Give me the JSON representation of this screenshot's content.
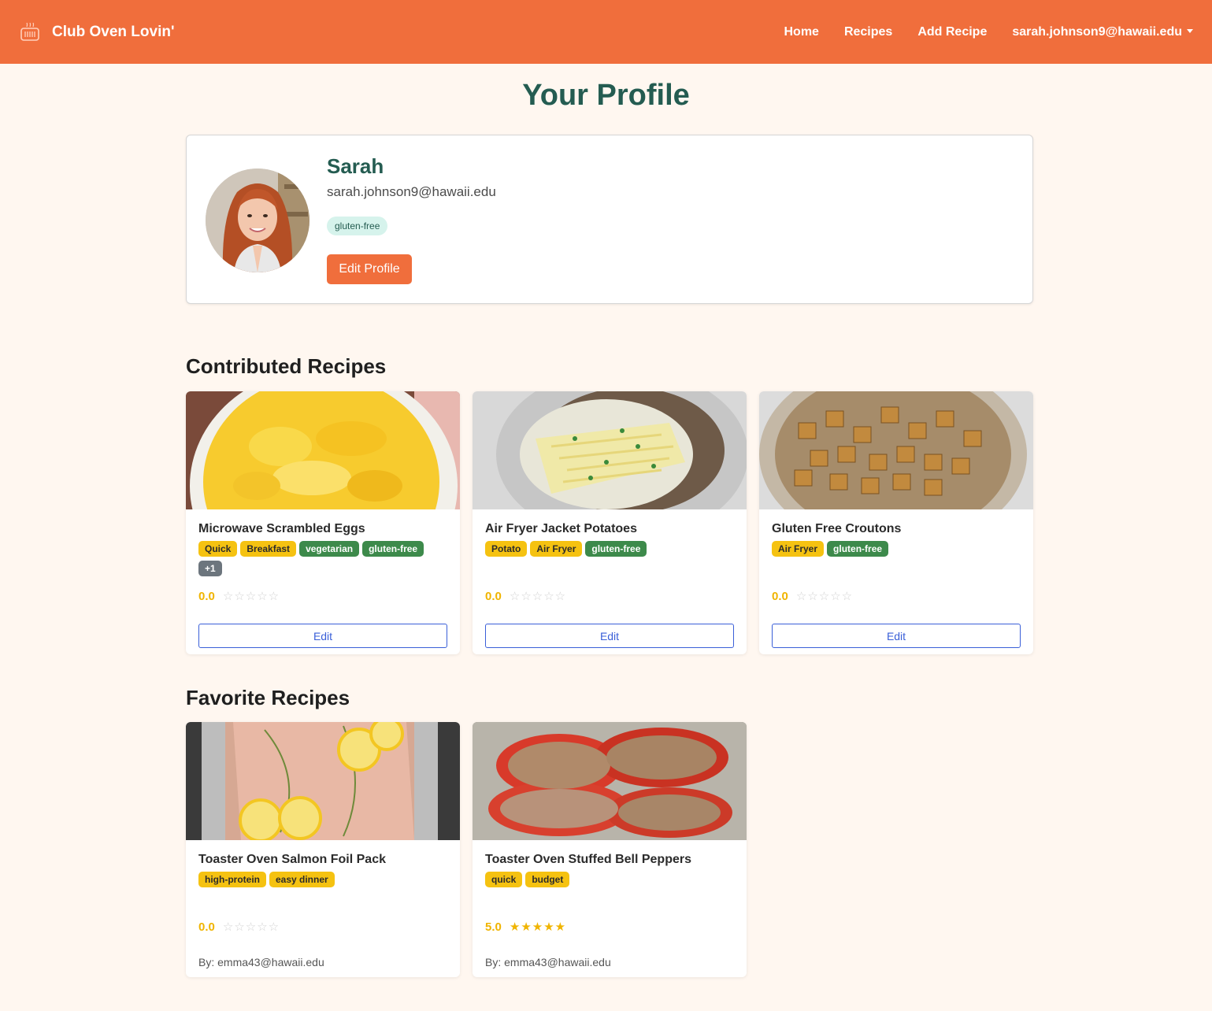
{
  "nav": {
    "brand": "Club Oven Lovin'",
    "brand_icon": "toaster-oven-icon",
    "links": [
      "Home",
      "Recipes",
      "Add Recipe"
    ],
    "user": "sarah.johnson9@hawaii.edu"
  },
  "page": {
    "title": "Your Profile"
  },
  "profile": {
    "name": "Sarah",
    "email": "sarah.johnson9@hawaii.edu",
    "dietary_tag": "gluten-free",
    "edit_label": "Edit Profile"
  },
  "contributed": {
    "heading": "Contributed Recipes",
    "recipes": [
      {
        "title": "Microwave Scrambled Eggs",
        "tags": [
          "Quick",
          "Breakfast",
          "vegetarian",
          "gluten-free",
          "+1"
        ],
        "rating": "0.0",
        "stars": 0,
        "button": "Edit"
      },
      {
        "title": "Air Fryer Jacket Potatoes",
        "tags": [
          "Potato",
          "Air Fryer",
          "gluten-free"
        ],
        "rating": "0.0",
        "stars": 0,
        "button": "Edit"
      },
      {
        "title": "Gluten Free Croutons",
        "tags": [
          "Air Fryer",
          "gluten-free"
        ],
        "rating": "0.0",
        "stars": 0,
        "button": "Edit"
      }
    ]
  },
  "favorites": {
    "heading": "Favorite Recipes",
    "recipes": [
      {
        "title": "Toaster Oven Salmon Foil Pack",
        "tags": [
          "high-protein",
          "easy dinner"
        ],
        "rating": "0.0",
        "stars": 0,
        "author": "By: emma43@hawaii.edu"
      },
      {
        "title": "Toaster Oven Stuffed Bell Peppers",
        "tags": [
          "quick",
          "budget"
        ],
        "rating": "5.0",
        "stars": 5,
        "author": "By: emma43@hawaii.edu"
      }
    ]
  },
  "colors": {
    "brand": "#f06e3c",
    "heading": "#245c51",
    "tag_yellow": "#f5c211",
    "tag_green": "#3d8a4b",
    "tag_gray": "#6c757d",
    "star": "#f0b400"
  }
}
